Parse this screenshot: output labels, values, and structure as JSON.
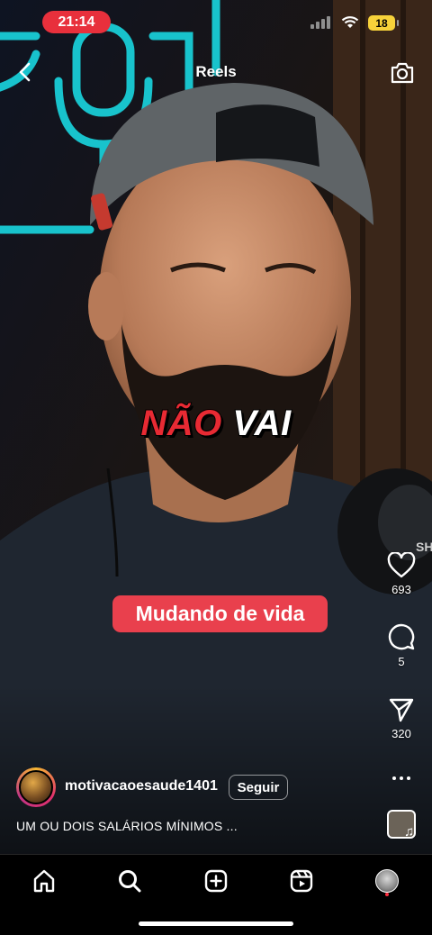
{
  "status_bar": {
    "time": "21:14",
    "battery": "18"
  },
  "header": {
    "title": "Reels"
  },
  "video": {
    "caption_words": [
      "NÃO",
      "VAI"
    ],
    "caption_pill": "Mudando de vida"
  },
  "actions": {
    "likes": "693",
    "comments": "5",
    "shares": "320"
  },
  "author": {
    "username": "motivacaoesaude1401",
    "follow_label": "Seguir",
    "description": "UM OU DOIS SALÁRIOS MÍNIMOS ..."
  },
  "icons": {
    "back": "chevron-left-icon",
    "camera": "camera-icon",
    "like": "heart-icon",
    "comment": "comment-bubble-icon",
    "share": "paper-plane-icon",
    "more": "ellipsis-icon",
    "home": "home-icon",
    "search": "search-icon",
    "create": "plus-square-icon",
    "reels": "reels-icon"
  },
  "colors": {
    "time_pill": "#e8303c",
    "caption_red": "#e82a33",
    "caption_pill": "#e9404d",
    "battery": "#f7d23a",
    "neon": "#19d6e0"
  }
}
